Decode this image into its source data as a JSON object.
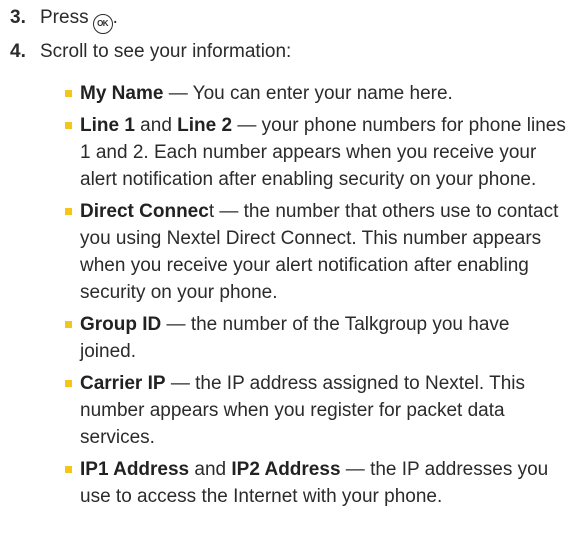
{
  "steps": [
    {
      "num": "3.",
      "text": "Press",
      "icon": "ok-key-icon",
      "icon_label": "OK",
      "suffix": "."
    },
    {
      "num": "4.",
      "text": "Scroll to see your information:"
    }
  ],
  "bullets": [
    {
      "term1": "My Name",
      "joiner": "",
      "term2": "",
      "tail_bold": "",
      "desc": " — You can enter your name here."
    },
    {
      "term1": "Line 1",
      "joiner": " and ",
      "term2": "Line 2",
      "tail_bold": "",
      "desc": " — your phone numbers for phone lines 1 and 2. Each number appears when you receive your alert notification after enabling security on your phone."
    },
    {
      "term1": "Direct Connec",
      "joiner": "",
      "term2": "",
      "tail_bold": "",
      "desc": "t — the number that others use to contact you using Nextel Direct Connect. This number appears when you receive your alert notification after enabling security on your phone."
    },
    {
      "term1": "Group ID",
      "joiner": "",
      "term2": "",
      "tail_bold": "",
      "desc": " — the number of the Talkgroup you have joined."
    },
    {
      "term1": "Carrier IP",
      "joiner": "",
      "term2": "",
      "tail_bold": "",
      "desc": " — the IP address assigned to Nextel. This number appears when you register for packet data services."
    },
    {
      "term1": "IP1 Address",
      "joiner": " and ",
      "term2": "IP2 Address",
      "tail_bold": "",
      "desc": " — the IP addresses you use to access the Internet with your phone."
    }
  ],
  "colors": {
    "bullet_marker": "#f5c518",
    "text": "#2b2b2b"
  }
}
